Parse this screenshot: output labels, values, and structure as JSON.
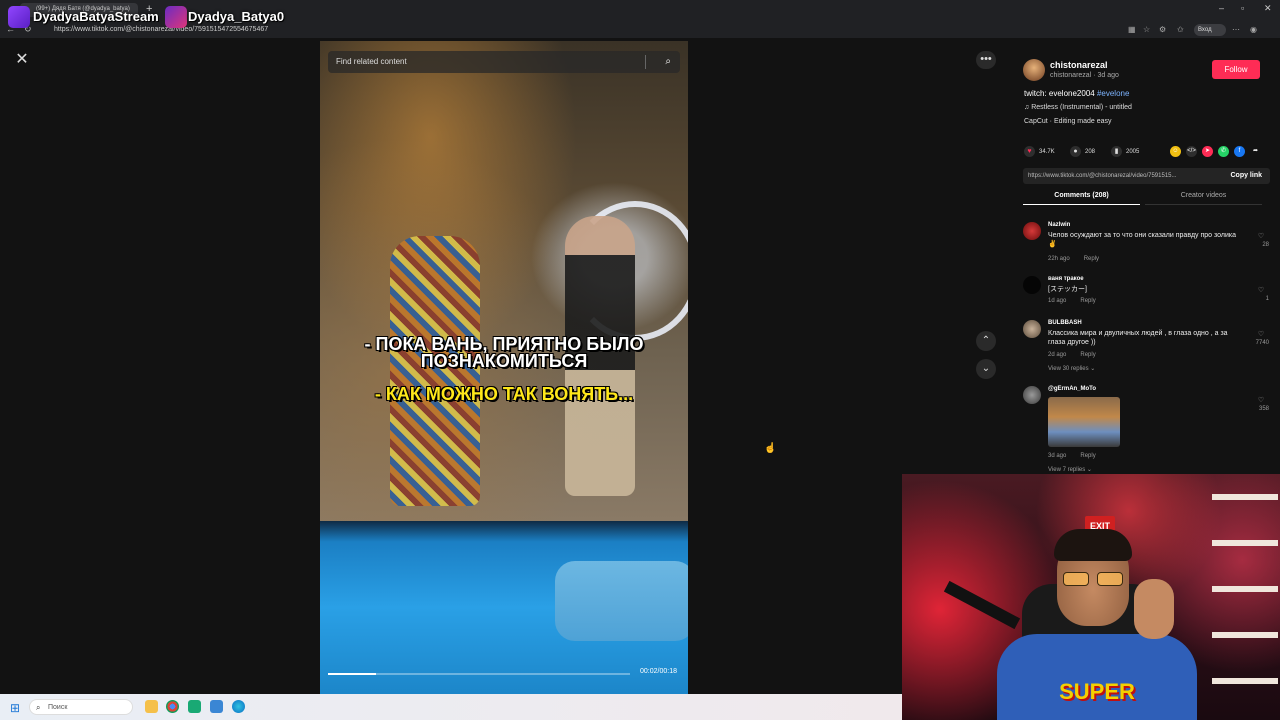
{
  "browser": {
    "tab_title": "(99+) Дядя Батя (@dyadya_batya)",
    "url": "https://www.tiktok.com/@chistonarezal/video/7591515472554675467",
    "profile_label": "Вход"
  },
  "overlay": {
    "channel1": "DyadyaBatyaStream",
    "channel2": "Dyadya_Batya0"
  },
  "video": {
    "search_placeholder": "Find related content",
    "subtitle_line1": "- ПОКА ВАНЬ, ПРИЯТНО БЫЛО",
    "subtitle_line2": "ПОЗНАКОМИТЬСЯ",
    "subtitle_yellow": "- КАК МОЖНО ТАК ВОНЯТЬ...",
    "time": "00:02/00:18",
    "progress": 0.16
  },
  "author": {
    "name": "chistonarezal",
    "handle_date": "chistonarezal · 3d ago",
    "follow_label": "Follow",
    "description": "twitch: evelone2004 ",
    "hashtag": "#evelone",
    "music": "♫ Restless (Instrumental) - untitled",
    "capcut": "CapCut · Editing made easy"
  },
  "stats": {
    "likes": "34.7K",
    "comments": "208",
    "saves": "2005"
  },
  "link": {
    "url": "https://www.tiktok.com/@chistonarezal/video/7591515...",
    "copy_label": "Copy link"
  },
  "tabs": {
    "comments": "Comments (208)",
    "creator": "Creator videos"
  },
  "comments": [
    {
      "author": "Nazlwin",
      "text": "Челов осуждают за то что они сказали правду про золика ✌",
      "time": "22h ago",
      "reply": "Reply",
      "likes": "28"
    },
    {
      "author": "ваня тракое",
      "text": "[ステッカー]",
      "time": "1d ago",
      "reply": "Reply",
      "likes": "1"
    },
    {
      "author": "BULBBASH",
      "text": "Классика мира и двуличных людей , в глаза одно , а за глаза другое ))",
      "time": "2d ago",
      "reply": "Reply",
      "likes": "7740",
      "view_replies": "View 30 replies ⌄"
    },
    {
      "author": "@gErmAn_MoTo",
      "text": "",
      "time": "3d ago",
      "reply": "Reply",
      "likes": "358",
      "view_replies": "View 7 replies ⌄"
    }
  ],
  "webcam": {
    "exit_sign": "EXIT",
    "shirt_text": "SUPER"
  },
  "taskbar": {
    "search_placeholder": "Поиск"
  },
  "colors": {
    "accent": "#fe2c55",
    "hashtag": "#7db4ff",
    "subtitle_yellow": "#ffe81a"
  }
}
